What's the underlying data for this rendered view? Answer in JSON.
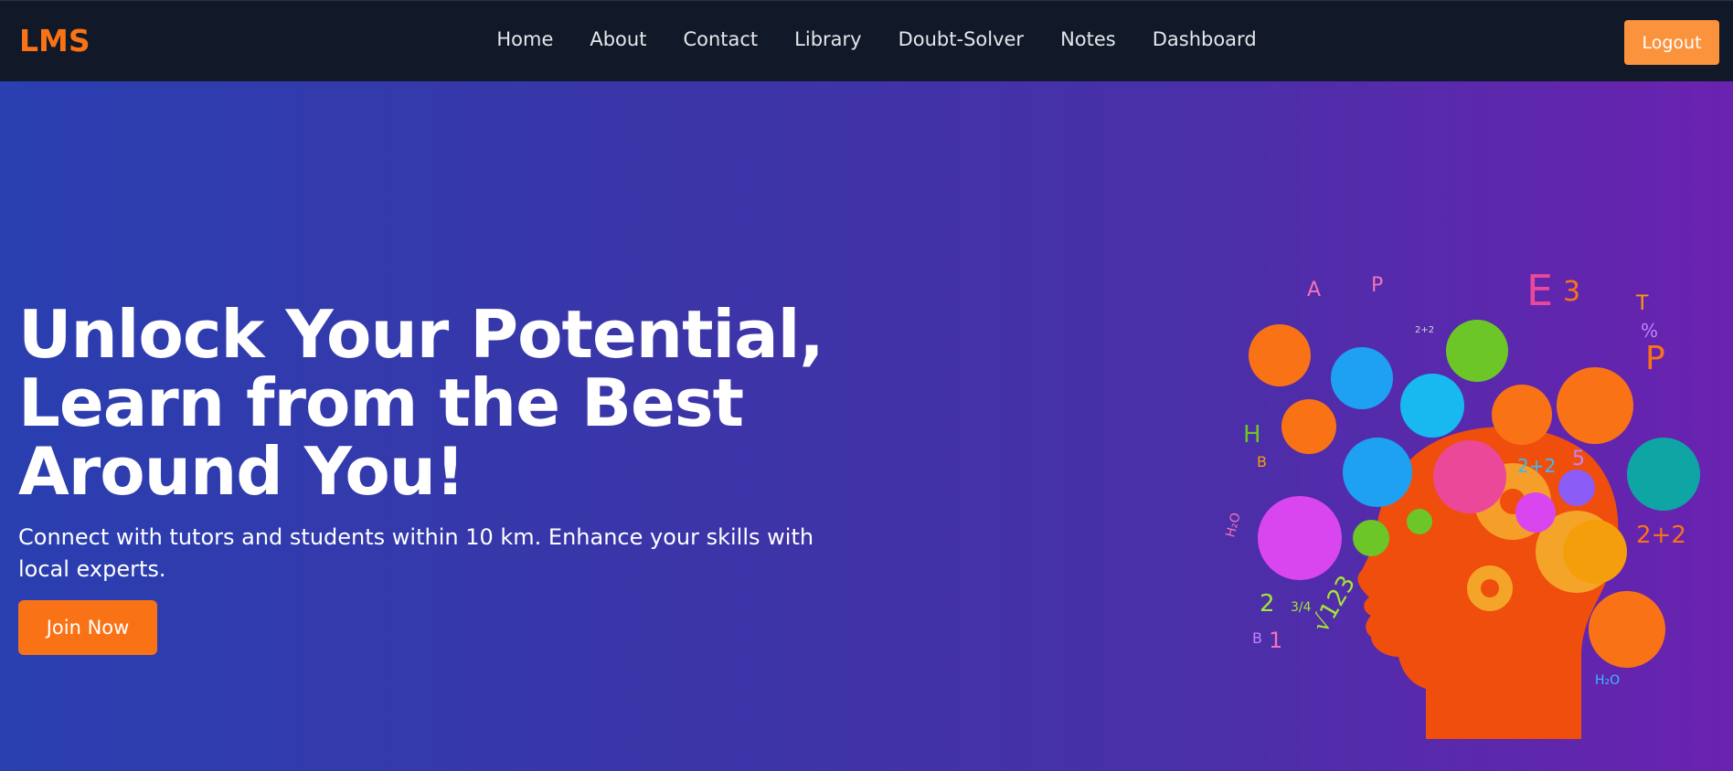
{
  "navbar": {
    "logo": "LMS",
    "links": [
      "Home",
      "About",
      "Contact",
      "Library",
      "Doubt-Solver",
      "Notes",
      "Dashboard"
    ],
    "logout_label": "Logout"
  },
  "hero": {
    "title_line1": "Unlock Your Potential,",
    "title_line2": "Learn from the Best",
    "title_line3": "Around You!",
    "subtitle": "Connect with tutors and students within 10 km. Enhance your skills with local experts.",
    "cta_label": "Join Now",
    "illustration_text": [
      "A",
      "P",
      "E",
      "3",
      "T",
      "%",
      "P",
      "H",
      "B",
      "2+2",
      "5",
      "2+2",
      "2",
      "3/4",
      "√123",
      "H₂O",
      "B",
      "1",
      "H₂O",
      "2+2"
    ]
  },
  "colors": {
    "navbar_bg": "#111827",
    "accent": "#f97316",
    "logout_bg": "#fb923c",
    "hero_gradient_start": "#2a3fb0",
    "hero_gradient_end": "#6a22b0",
    "head": "#f04e0c",
    "gear": "#f59e2a"
  }
}
